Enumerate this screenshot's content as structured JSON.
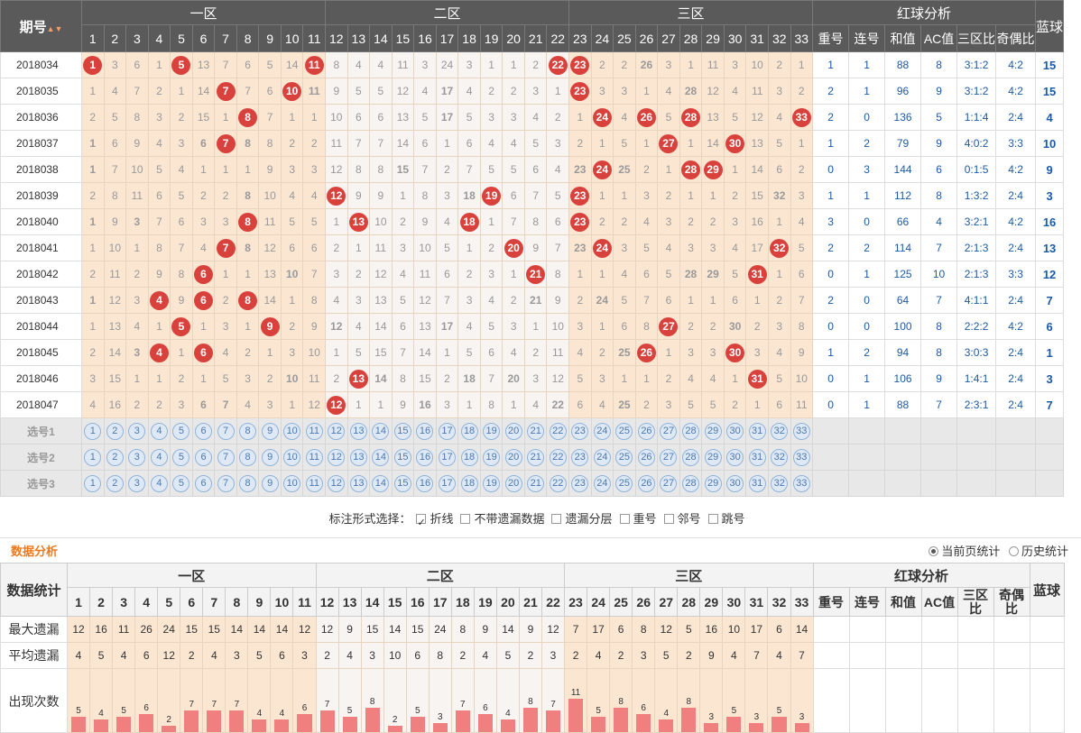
{
  "header": {
    "qi": "期号",
    "sort_icon": "sort-up-down-icon",
    "zones": [
      "一区",
      "二区",
      "三区"
    ],
    "analysis": "红球分析",
    "blue": "蓝球",
    "analysis_cols": [
      "重号",
      "连号",
      "和值",
      "AC值",
      "三区比",
      "奇偶比"
    ]
  },
  "rows": [
    {
      "qi": "2018034",
      "vals": [
        1,
        3,
        6,
        1,
        5,
        13,
        7,
        6,
        5,
        14,
        11,
        8,
        4,
        4,
        11,
        3,
        24,
        3,
        1,
        1,
        2,
        22,
        23,
        2,
        2,
        26,
        3,
        1,
        11,
        3,
        10,
        2,
        1
      ],
      "hit": [
        1,
        5,
        11,
        22,
        23,
        26
      ],
      "an": [
        "1",
        "1",
        "88",
        "8",
        "3:1:2",
        "4:2"
      ],
      "blue": "15"
    },
    {
      "qi": "2018035",
      "vals": [
        1,
        4,
        7,
        2,
        1,
        14,
        7,
        7,
        6,
        10,
        11,
        9,
        5,
        5,
        12,
        4,
        17,
        4,
        2,
        2,
        3,
        1,
        23,
        3,
        3,
        1,
        4,
        28,
        12,
        4,
        11,
        3,
        2
      ],
      "hit": [
        7,
        10,
        11,
        17,
        23,
        28
      ],
      "an": [
        "2",
        "1",
        "96",
        "9",
        "3:1:2",
        "4:2"
      ],
      "blue": "15"
    },
    {
      "qi": "2018036",
      "vals": [
        2,
        5,
        8,
        3,
        2,
        15,
        1,
        8,
        7,
        1,
        1,
        10,
        6,
        6,
        13,
        5,
        17,
        5,
        3,
        3,
        4,
        2,
        1,
        24,
        4,
        26,
        5,
        28,
        13,
        5,
        12,
        4,
        33
      ],
      "hit": [
        8,
        17,
        24,
        26,
        28,
        33
      ],
      "an": [
        "2",
        "0",
        "136",
        "5",
        "1:1:4",
        "2:4"
      ],
      "blue": "4"
    },
    {
      "qi": "2018037",
      "vals": [
        1,
        6,
        9,
        4,
        3,
        6,
        7,
        8,
        8,
        2,
        2,
        11,
        7,
        7,
        14,
        6,
        1,
        6,
        4,
        4,
        5,
        3,
        2,
        1,
        5,
        1,
        27,
        1,
        14,
        30,
        13,
        5,
        1
      ],
      "hit": [
        1,
        6,
        7,
        8,
        27,
        30
      ],
      "an": [
        "1",
        "2",
        "79",
        "9",
        "4:0:2",
        "3:3"
      ],
      "blue": "10"
    },
    {
      "qi": "2018038",
      "vals": [
        1,
        7,
        10,
        5,
        4,
        1,
        1,
        1,
        9,
        3,
        3,
        12,
        8,
        8,
        15,
        7,
        2,
        7,
        5,
        5,
        6,
        4,
        23,
        24,
        25,
        2,
        1,
        28,
        29,
        1,
        14,
        6,
        2
      ],
      "hit": [
        1,
        15,
        23,
        24,
        25,
        28,
        29
      ],
      "an": [
        "0",
        "3",
        "144",
        "6",
        "0:1:5",
        "4:2"
      ],
      "blue": "9"
    },
    {
      "qi": "2018039",
      "vals": [
        2,
        8,
        11,
        6,
        5,
        2,
        2,
        8,
        10,
        4,
        4,
        12,
        9,
        9,
        1,
        8,
        3,
        18,
        19,
        6,
        7,
        5,
        23,
        1,
        1,
        3,
        2,
        1,
        1,
        2,
        15,
        32,
        3
      ],
      "hit": [
        8,
        12,
        18,
        19,
        23,
        32
      ],
      "an": [
        "1",
        "1",
        "112",
        "8",
        "1:3:2",
        "2:4"
      ],
      "blue": "3"
    },
    {
      "qi": "2018040",
      "vals": [
        1,
        9,
        3,
        7,
        6,
        3,
        3,
        8,
        11,
        5,
        5,
        1,
        13,
        10,
        2,
        9,
        4,
        18,
        1,
        7,
        8,
        6,
        23,
        2,
        2,
        4,
        3,
        2,
        2,
        3,
        16,
        1,
        4
      ],
      "hit": [
        1,
        3,
        8,
        13,
        18,
        23
      ],
      "an": [
        "3",
        "0",
        "66",
        "4",
        "3:2:1",
        "4:2"
      ],
      "blue": "16"
    },
    {
      "qi": "2018041",
      "vals": [
        1,
        10,
        1,
        8,
        7,
        4,
        7,
        8,
        12,
        6,
        6,
        2,
        1,
        11,
        3,
        10,
        5,
        1,
        2,
        20,
        9,
        7,
        23,
        24,
        3,
        5,
        4,
        3,
        3,
        4,
        17,
        32,
        5
      ],
      "hit": [
        7,
        8,
        20,
        23,
        24,
        32
      ],
      "an": [
        "2",
        "2",
        "114",
        "7",
        "2:1:3",
        "2:4"
      ],
      "blue": "13"
    },
    {
      "qi": "2018042",
      "vals": [
        2,
        11,
        2,
        9,
        8,
        6,
        1,
        1,
        13,
        10,
        7,
        3,
        2,
        12,
        4,
        11,
        6,
        2,
        3,
        1,
        21,
        8,
        1,
        1,
        4,
        6,
        5,
        28,
        29,
        5,
        31,
        1,
        6
      ],
      "hit": [
        6,
        10,
        21,
        28,
        29,
        31
      ],
      "an": [
        "0",
        "1",
        "125",
        "10",
        "2:1:3",
        "3:3"
      ],
      "blue": "12"
    },
    {
      "qi": "2018043",
      "vals": [
        1,
        12,
        3,
        4,
        9,
        6,
        2,
        8,
        14,
        1,
        8,
        4,
        3,
        13,
        5,
        12,
        7,
        3,
        4,
        2,
        21,
        9,
        2,
        24,
        5,
        7,
        6,
        1,
        1,
        6,
        1,
        2,
        7
      ],
      "hit": [
        1,
        4,
        6,
        8,
        21,
        24
      ],
      "an": [
        "2",
        "0",
        "64",
        "7",
        "4:1:1",
        "2:4"
      ],
      "blue": "7"
    },
    {
      "qi": "2018044",
      "vals": [
        1,
        13,
        4,
        1,
        5,
        1,
        3,
        1,
        9,
        2,
        9,
        12,
        4,
        14,
        6,
        13,
        17,
        4,
        5,
        3,
        1,
        10,
        3,
        1,
        6,
        8,
        27,
        2,
        2,
        30,
        2,
        3,
        8
      ],
      "hit": [
        5,
        9,
        12,
        17,
        27,
        30
      ],
      "an": [
        "0",
        "0",
        "100",
        "8",
        "2:2:2",
        "4:2"
      ],
      "blue": "6"
    },
    {
      "qi": "2018045",
      "vals": [
        2,
        14,
        3,
        4,
        1,
        6,
        4,
        2,
        1,
        3,
        10,
        1,
        5,
        15,
        7,
        14,
        1,
        5,
        6,
        4,
        2,
        11,
        4,
        2,
        25,
        26,
        1,
        3,
        3,
        30,
        3,
        4,
        9
      ],
      "hit": [
        3,
        4,
        6,
        25,
        26,
        30
      ],
      "an": [
        "1",
        "2",
        "94",
        "8",
        "3:0:3",
        "2:4"
      ],
      "blue": "1"
    },
    {
      "qi": "2018046",
      "vals": [
        3,
        15,
        1,
        1,
        2,
        1,
        5,
        3,
        2,
        10,
        11,
        2,
        13,
        14,
        8,
        15,
        2,
        18,
        7,
        20,
        3,
        12,
        5,
        3,
        1,
        1,
        2,
        4,
        4,
        1,
        31,
        5,
        10
      ],
      "hit": [
        10,
        13,
        14,
        18,
        20,
        31
      ],
      "an": [
        "0",
        "1",
        "106",
        "9",
        "1:4:1",
        "2:4"
      ],
      "blue": "3"
    },
    {
      "qi": "2018047",
      "vals": [
        4,
        16,
        2,
        2,
        3,
        6,
        7,
        4,
        3,
        1,
        12,
        12,
        1,
        1,
        9,
        16,
        3,
        1,
        8,
        1,
        4,
        22,
        6,
        4,
        25,
        2,
        3,
        5,
        5,
        2,
        1,
        6,
        11
      ],
      "hit": [
        6,
        7,
        12,
        16,
        22,
        25
      ],
      "an": [
        "0",
        "1",
        "88",
        "7",
        "2:3:1",
        "2:4"
      ],
      "blue": "7"
    }
  ],
  "hit_ball": [
    [
      1,
      5,
      11,
      22,
      23
    ],
    [
      7,
      10,
      23
    ],
    [
      8,
      24,
      26,
      28,
      33
    ],
    [
      7,
      27,
      30
    ],
    [
      24,
      28,
      29
    ],
    [
      12,
      19,
      23
    ],
    [
      8,
      13,
      18,
      23
    ],
    [
      7,
      20,
      24,
      32
    ],
    [
      6,
      21,
      31
    ],
    [
      4,
      6,
      8
    ],
    [
      5,
      9,
      27
    ],
    [
      4,
      6,
      26,
      30
    ],
    [
      13,
      31
    ],
    [
      12
    ]
  ],
  "hit_bold": [
    [
      26
    ],
    [
      11,
      17,
      28
    ],
    [
      17
    ],
    [
      1,
      6,
      8
    ],
    [
      1,
      15,
      23,
      25
    ],
    [
      8,
      18,
      32
    ],
    [
      1,
      3
    ],
    [
      8,
      23
    ],
    [
      10,
      28,
      29
    ],
    [
      1,
      21,
      24
    ],
    [
      12,
      17,
      30
    ],
    [
      3,
      25
    ],
    [
      10,
      14,
      18,
      20
    ],
    [
      6,
      7,
      16,
      22,
      25
    ]
  ],
  "select_rows": [
    "选号1",
    "选号2",
    "选号3"
  ],
  "options": {
    "label": "标注形式选择：",
    "items": [
      {
        "text": "折线",
        "on": true
      },
      {
        "text": "不带遗漏数据",
        "on": false
      },
      {
        "text": "遗漏分层",
        "on": false
      },
      {
        "text": "重号",
        "on": false
      },
      {
        "text": "邻号",
        "on": false
      },
      {
        "text": "跳号",
        "on": false
      }
    ]
  },
  "analysis": {
    "title": "数据分析",
    "radio1": "当前页统计",
    "radio2": "历史统计"
  },
  "stats": {
    "label": "数据统计",
    "cols": [
      "重号",
      "连号",
      "和值",
      "AC值",
      "三区比",
      "奇偶比",
      "蓝球"
    ],
    "max_label": "最大遗漏",
    "max": [
      12,
      16,
      11,
      26,
      24,
      15,
      15,
      14,
      14,
      14,
      12,
      12,
      9,
      15,
      14,
      15,
      24,
      8,
      9,
      14,
      9,
      12,
      7,
      17,
      6,
      8,
      12,
      5,
      16,
      10,
      17,
      6,
      14
    ],
    "avg_label": "平均遗漏",
    "avg": [
      4,
      5,
      4,
      6,
      12,
      2,
      4,
      3,
      5,
      6,
      3,
      2,
      4,
      3,
      10,
      6,
      8,
      2,
      4,
      5,
      2,
      3,
      2,
      4,
      2,
      3,
      5,
      2,
      9,
      4,
      7,
      4,
      7
    ],
    "count_label": "出现次数",
    "count": [
      5,
      4,
      5,
      6,
      2,
      7,
      7,
      7,
      4,
      4,
      6,
      7,
      5,
      8,
      2,
      5,
      3,
      7,
      6,
      4,
      8,
      7,
      11,
      5,
      8,
      6,
      4,
      8,
      3,
      5,
      3,
      5,
      3
    ]
  }
}
